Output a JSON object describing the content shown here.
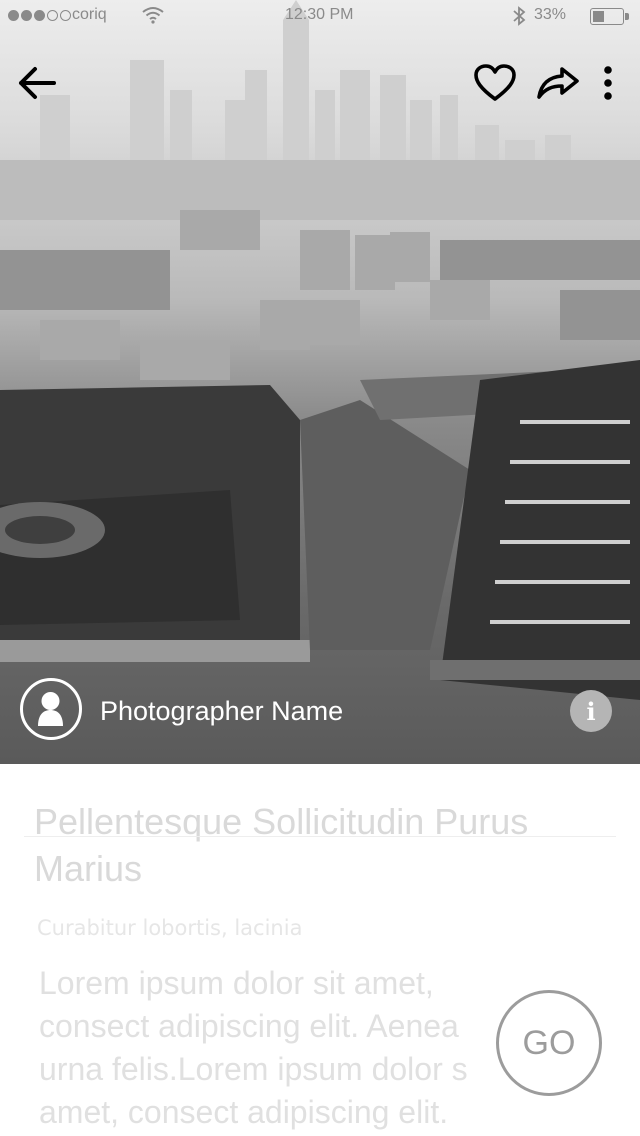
{
  "status_bar": {
    "carrier": "coriq",
    "signal_bars_filled": 3,
    "signal_bars_total": 5,
    "time": "12:30 PM",
    "battery": "33%",
    "battery_level": 0.33,
    "icons": [
      "wifi-icon",
      "bluetooth-icon",
      "battery-icon"
    ]
  },
  "top_actions": {
    "icons": [
      "back-arrow-icon",
      "heart-icon",
      "share-icon",
      "more-vertical-icon"
    ]
  },
  "photographer": {
    "name": "Photographer Name",
    "avatar_icon": "user-silhouette-icon",
    "info_label": "i"
  },
  "content": {
    "title": "Pellentesque Sollicitudin Purus Marius",
    "subtitle": "Curabitur lobortis, lacinia",
    "body_lines": [
      "Lorem ipsum dolor sit amet,",
      "consect adipiscing elit. Aenea",
      "urna felis.Lorem ipsum dolor s",
      "amet, consect adipiscing elit."
    ],
    "go_label": "GO"
  },
  "colors": {
    "hero_overlay": "#5a5a5a",
    "text_faded": "#d9d9d9",
    "go_border": "#9c9c9c",
    "white": "#ffffff"
  }
}
